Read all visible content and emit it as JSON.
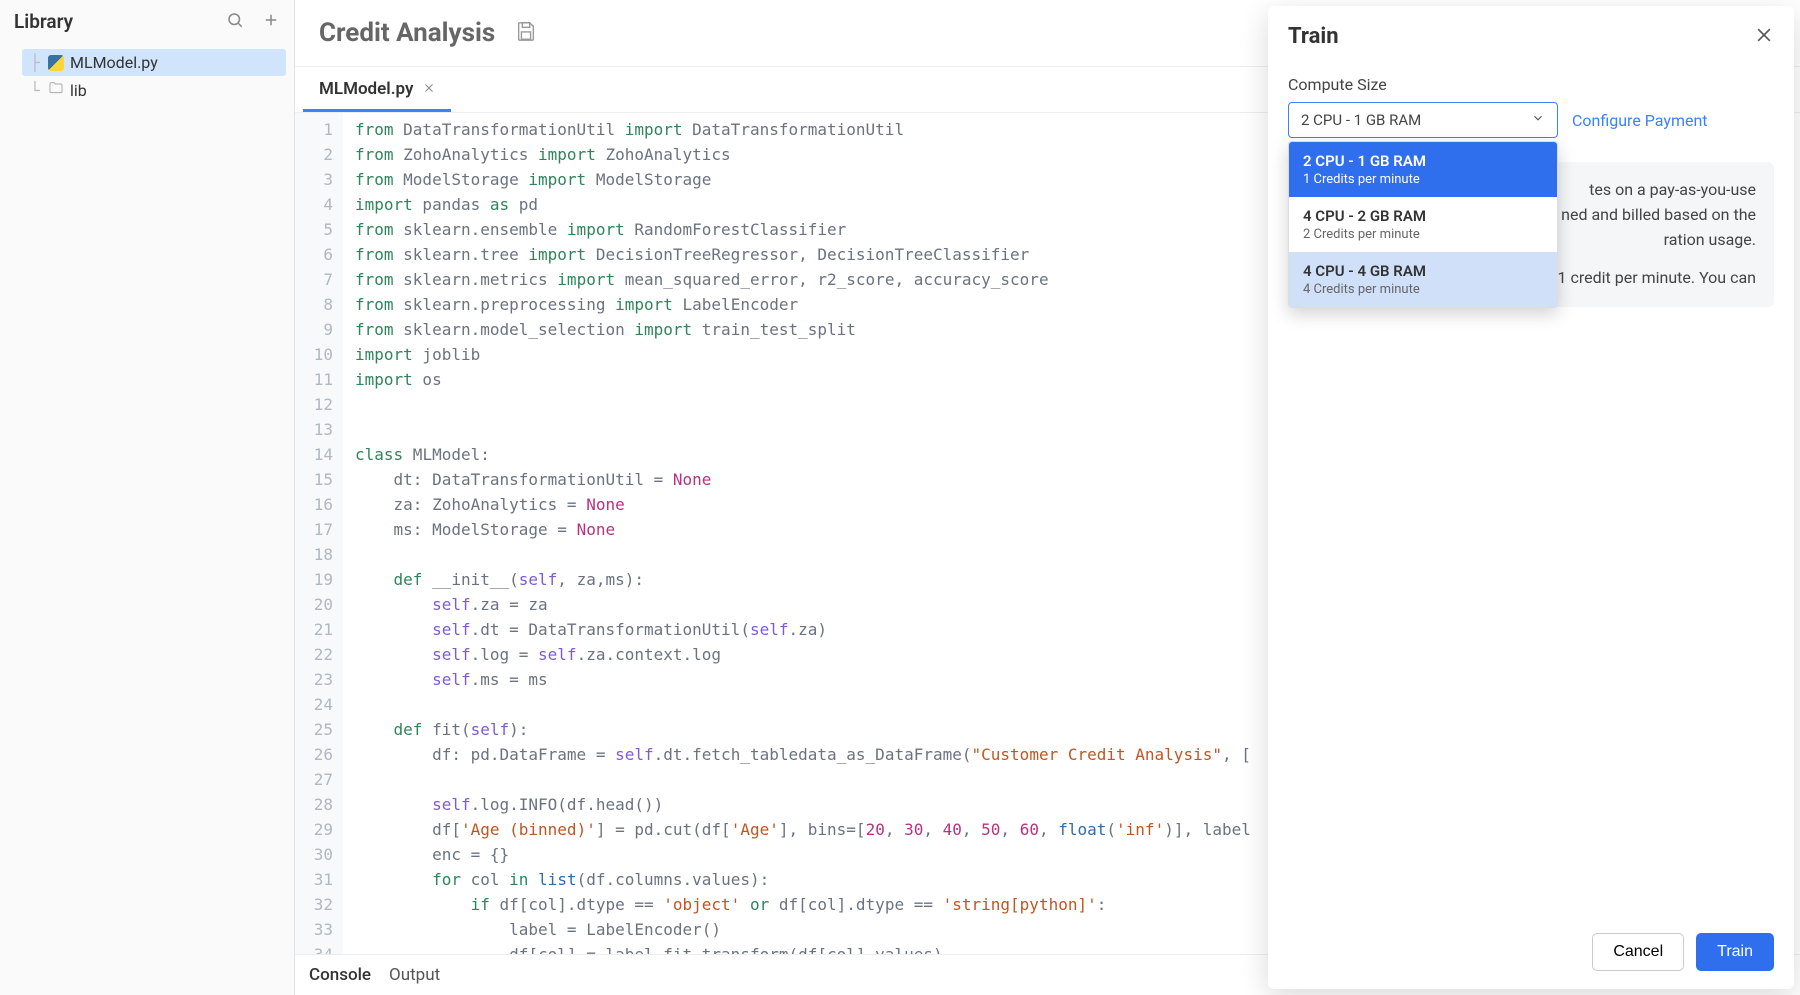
{
  "sidebar": {
    "title": "Library",
    "items": [
      {
        "label": "MLModel.py",
        "type": "python",
        "selected": true
      },
      {
        "label": "lib",
        "type": "folder",
        "selected": false
      }
    ]
  },
  "header": {
    "title": "Credit Analysis"
  },
  "tabs": [
    {
      "label": "MLModel.py",
      "active": true
    }
  ],
  "code_lines": [
    [
      [
        "kw",
        "from"
      ],
      [
        "",
        " DataTransformationUtil "
      ],
      [
        "kw",
        "import"
      ],
      [
        "",
        " DataTransformationUtil"
      ]
    ],
    [
      [
        "kw",
        "from"
      ],
      [
        "",
        " ZohoAnalytics "
      ],
      [
        "kw",
        "import"
      ],
      [
        "",
        " ZohoAnalytics"
      ]
    ],
    [
      [
        "kw",
        "from"
      ],
      [
        "",
        " ModelStorage "
      ],
      [
        "kw",
        "import"
      ],
      [
        "",
        " ModelStorage"
      ]
    ],
    [
      [
        "kw",
        "import"
      ],
      [
        "",
        " pandas "
      ],
      [
        "kw",
        "as"
      ],
      [
        "",
        " pd"
      ]
    ],
    [
      [
        "kw",
        "from"
      ],
      [
        "",
        " sklearn.ensemble "
      ],
      [
        "kw",
        "import"
      ],
      [
        "",
        " RandomForestClassifier"
      ]
    ],
    [
      [
        "kw",
        "from"
      ],
      [
        "",
        " sklearn.tree "
      ],
      [
        "kw",
        "import"
      ],
      [
        "",
        " DecisionTreeRegressor, DecisionTreeClassifier"
      ]
    ],
    [
      [
        "kw",
        "from"
      ],
      [
        "",
        " sklearn.metrics "
      ],
      [
        "kw",
        "import"
      ],
      [
        "",
        " mean_squared_error, r2_score, accuracy_score"
      ]
    ],
    [
      [
        "kw",
        "from"
      ],
      [
        "",
        " sklearn.preprocessing "
      ],
      [
        "kw",
        "import"
      ],
      [
        "",
        " LabelEncoder"
      ]
    ],
    [
      [
        "kw",
        "from"
      ],
      [
        "",
        " sklearn.model_selection "
      ],
      [
        "kw",
        "import"
      ],
      [
        "",
        " train_test_split"
      ]
    ],
    [
      [
        "kw",
        "import"
      ],
      [
        "",
        " joblib"
      ]
    ],
    [
      [
        "kw",
        "import"
      ],
      [
        "",
        " os"
      ]
    ],
    [
      [
        "",
        ""
      ]
    ],
    [
      [
        "",
        ""
      ]
    ],
    [
      [
        "kw",
        "class"
      ],
      [
        "",
        " MLModel:"
      ]
    ],
    [
      [
        "",
        "    dt: DataTransformationUtil = "
      ],
      [
        "none",
        "None"
      ]
    ],
    [
      [
        "",
        "    za: ZohoAnalytics = "
      ],
      [
        "none",
        "None"
      ]
    ],
    [
      [
        "",
        "    ms: ModelStorage = "
      ],
      [
        "none",
        "None"
      ]
    ],
    [
      [
        "",
        ""
      ]
    ],
    [
      [
        "",
        "    "
      ],
      [
        "kw",
        "def"
      ],
      [
        "",
        " __init__("
      ],
      [
        "self",
        "self"
      ],
      [
        "",
        ", za,ms):"
      ]
    ],
    [
      [
        "",
        "        "
      ],
      [
        "self",
        "self"
      ],
      [
        "",
        ".za = za"
      ]
    ],
    [
      [
        "",
        "        "
      ],
      [
        "self",
        "self"
      ],
      [
        "",
        ".dt = DataTransformationUtil("
      ],
      [
        "self",
        "self"
      ],
      [
        "",
        ".za)"
      ]
    ],
    [
      [
        "",
        "        "
      ],
      [
        "self",
        "self"
      ],
      [
        "",
        ".log = "
      ],
      [
        "self",
        "self"
      ],
      [
        "",
        ".za.context.log"
      ]
    ],
    [
      [
        "",
        "        "
      ],
      [
        "self",
        "self"
      ],
      [
        "",
        ".ms = ms"
      ]
    ],
    [
      [
        "",
        ""
      ]
    ],
    [
      [
        "",
        "    "
      ],
      [
        "kw",
        "def"
      ],
      [
        "",
        " fit("
      ],
      [
        "self",
        "self"
      ],
      [
        "",
        "):"
      ]
    ],
    [
      [
        "",
        "        df: pd.DataFrame = "
      ],
      [
        "self",
        "self"
      ],
      [
        "",
        ".dt.fetch_tabledata_as_DataFrame("
      ],
      [
        "str",
        "\"Customer Credit Analysis\""
      ],
      [
        "",
        ", ["
      ]
    ],
    [
      [
        "",
        ""
      ]
    ],
    [
      [
        "",
        "        "
      ],
      [
        "self",
        "self"
      ],
      [
        "",
        ".log.INFO(df.head())"
      ]
    ],
    [
      [
        "",
        "        df["
      ],
      [
        "str",
        "'Age (binned)'"
      ],
      [
        "",
        "] = pd.cut(df["
      ],
      [
        "str",
        "'Age'"
      ],
      [
        "",
        "], bins=["
      ],
      [
        "num",
        "20"
      ],
      [
        "",
        ", "
      ],
      [
        "num",
        "30"
      ],
      [
        "",
        ", "
      ],
      [
        "num",
        "40"
      ],
      [
        "",
        ", "
      ],
      [
        "num",
        "50"
      ],
      [
        "",
        ", "
      ],
      [
        "num",
        "60"
      ],
      [
        "",
        ", "
      ],
      [
        "builtin",
        "float"
      ],
      [
        "",
        "("
      ],
      [
        "str",
        "'inf'"
      ],
      [
        "",
        ")], label"
      ]
    ],
    [
      [
        "",
        "        enc = {}"
      ]
    ],
    [
      [
        "",
        "        "
      ],
      [
        "kw",
        "for"
      ],
      [
        "",
        " col "
      ],
      [
        "kw",
        "in"
      ],
      [
        "",
        " "
      ],
      [
        "builtin",
        "list"
      ],
      [
        "",
        "(df.columns.values):"
      ]
    ],
    [
      [
        "",
        "            "
      ],
      [
        "kw",
        "if"
      ],
      [
        "",
        " df[col].dtype == "
      ],
      [
        "str",
        "'object'"
      ],
      [
        "",
        " "
      ],
      [
        "kw",
        "or"
      ],
      [
        "",
        " df[col].dtype == "
      ],
      [
        "str",
        "'string[python]'"
      ],
      [
        "",
        ":"
      ]
    ],
    [
      [
        "",
        "                label = LabelEncoder()"
      ]
    ],
    [
      [
        "",
        "                df[col] = label.fit_transform(df[col].values)"
      ]
    ]
  ],
  "bottom_tabs": [
    {
      "label": "Console",
      "active": true
    },
    {
      "label": "Output",
      "active": false
    }
  ],
  "panel": {
    "title": "Train",
    "compute_label": "Compute Size",
    "selected_option": "2 CPU - 1 GB RAM",
    "configure_link": "Configure Payment",
    "options": [
      {
        "title": "2 CPU - 1 GB RAM",
        "sub": "1 Credits per minute",
        "state": "selected"
      },
      {
        "title": "4 CPU - 2 GB RAM",
        "sub": "2 Credits per minute",
        "state": ""
      },
      {
        "title": "4 CPU - 4 GB RAM",
        "sub": "4 Credits per minute",
        "state": "hover"
      }
    ],
    "info_line1_tail": "tes on a pay-as-you-use",
    "info_line2_tail": "ned and billed based on the",
    "info_line3_tail": "ration usage.",
    "info_line4_tail": "1 credit per minute. You can",
    "cancel_label": "Cancel",
    "train_label": "Train"
  }
}
